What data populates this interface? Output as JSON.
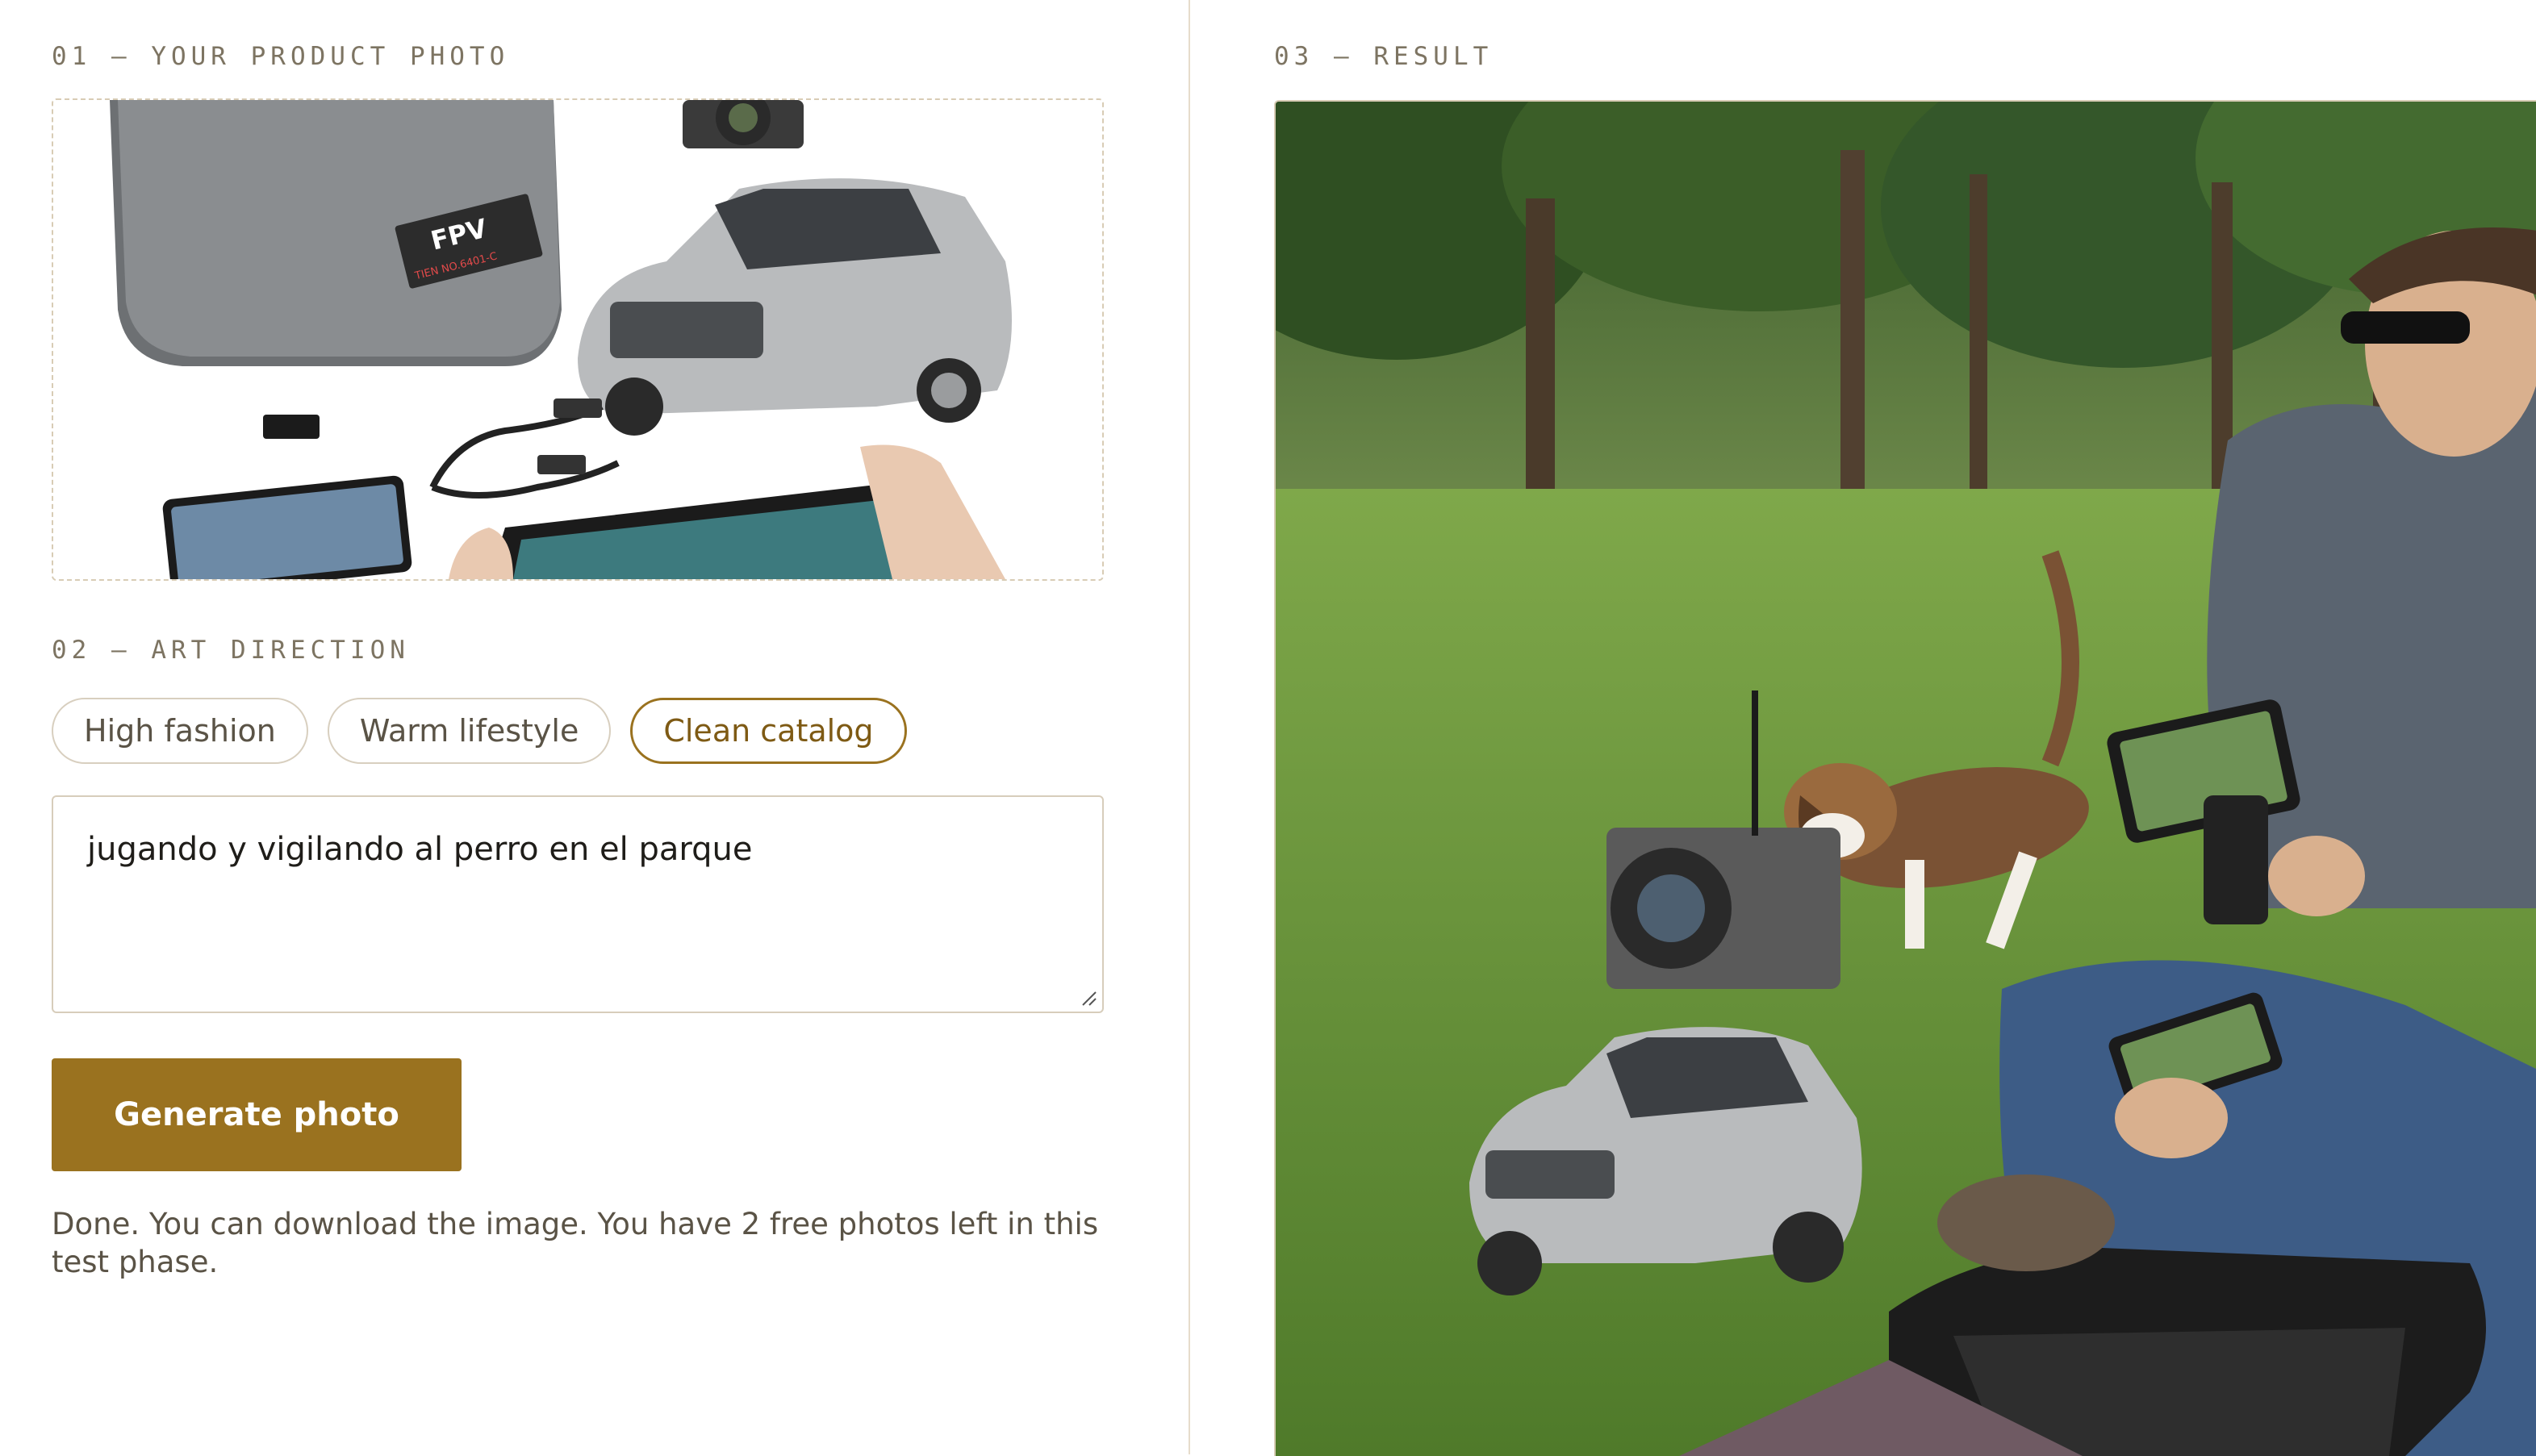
{
  "steps": {
    "upload_label": "01 — YOUR PRODUCT PHOTO",
    "direction_label": "02 — ART DIRECTION",
    "result_label": "03 — RESULT"
  },
  "product_photo": {
    "case_brand": "FPV",
    "case_tag": "TIEN NO.6401-C"
  },
  "art_direction": {
    "options": [
      {
        "label": "High fashion",
        "selected": false
      },
      {
        "label": "Warm lifestyle",
        "selected": false
      },
      {
        "label": "Clean catalog",
        "selected": true
      }
    ],
    "prompt_text": "jugando y vigilando al perro en el parque"
  },
  "generate_button": {
    "label": "Generate photo"
  },
  "status_message": "Done. You can download the image. You have 2 free photos left in this test phase.",
  "colors": {
    "accent": "#9a721f",
    "divider": "#e6dccb",
    "muted_text": "#7d7462"
  }
}
